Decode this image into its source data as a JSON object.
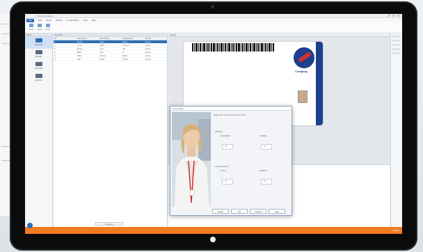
{
  "window": {
    "title": "ID card designer"
  },
  "menu": {
    "file": "File",
    "items": [
      "Edit",
      "Home",
      "Design",
      "Configuration",
      "View",
      "Help"
    ]
  },
  "ribbon": {
    "buttons": [
      "New",
      "Open",
      "Print"
    ]
  },
  "nav": {
    "header": "Menu",
    "items": [
      "Records",
      "Design",
      "Template",
      "Reports"
    ]
  },
  "records": {
    "header": "Records",
    "columns": [
      "ID",
      "Last Name",
      "First Name",
      "Department",
      "Status"
    ],
    "rows": [
      [
        "1",
        "Smith",
        "Anna",
        "Sales",
        "Active"
      ],
      [
        "2",
        "Jones",
        "Mark",
        "Finance",
        "Active"
      ],
      [
        "3",
        "Brown",
        "Lisa",
        "HR",
        "Active"
      ],
      [
        "4",
        "Miller",
        "Tom",
        "IT",
        "Active"
      ],
      [
        "5",
        "Clark",
        "Emma",
        "Sales",
        "Active"
      ],
      [
        "6",
        "Hall",
        "Ryan",
        "Admin",
        "Active"
      ]
    ],
    "footer": "Records"
  },
  "designer": {
    "header": "Design",
    "card_brand": "Company"
  },
  "props": {
    "rows": [
      {
        "label": "Last Name",
        "value": "Smith"
      },
      {
        "label": "First Name",
        "value": "Anna"
      },
      {
        "label": "ID",
        "value": "1"
      },
      {
        "label": "Department",
        "value": "Sales"
      },
      {
        "label": "Valid From",
        "value": ""
      },
      {
        "label": "Valid To",
        "value": ""
      }
    ],
    "rows2": [
      {
        "label": "Card Number",
        "value": ""
      },
      {
        "label": "Field 1",
        "value": ""
      },
      {
        "label": "Field 2",
        "value": ""
      },
      {
        "label": "Field 3",
        "value": ""
      }
    ]
  },
  "dialog": {
    "title": "Crop image",
    "instructions": "Adjust the image for the card photo",
    "section1": "Position",
    "horizontal_label": "Horizontal",
    "horizontal_value": "0",
    "vertical_label": "Vertical",
    "vertical_value": "0",
    "section2": "Size and zoom",
    "zoom_label": "Zoom",
    "zoom_value": "0",
    "rotate_label": "Rotation",
    "rotate_value": "0",
    "buttons": [
      "Reset",
      "OK",
      "Cancel",
      "Help"
    ]
  },
  "status": {
    "text": "Ready"
  },
  "colors": {
    "accent": "#2f6db5",
    "statusbar": "#f27a1f",
    "card_brand": "#1c3f8e"
  }
}
